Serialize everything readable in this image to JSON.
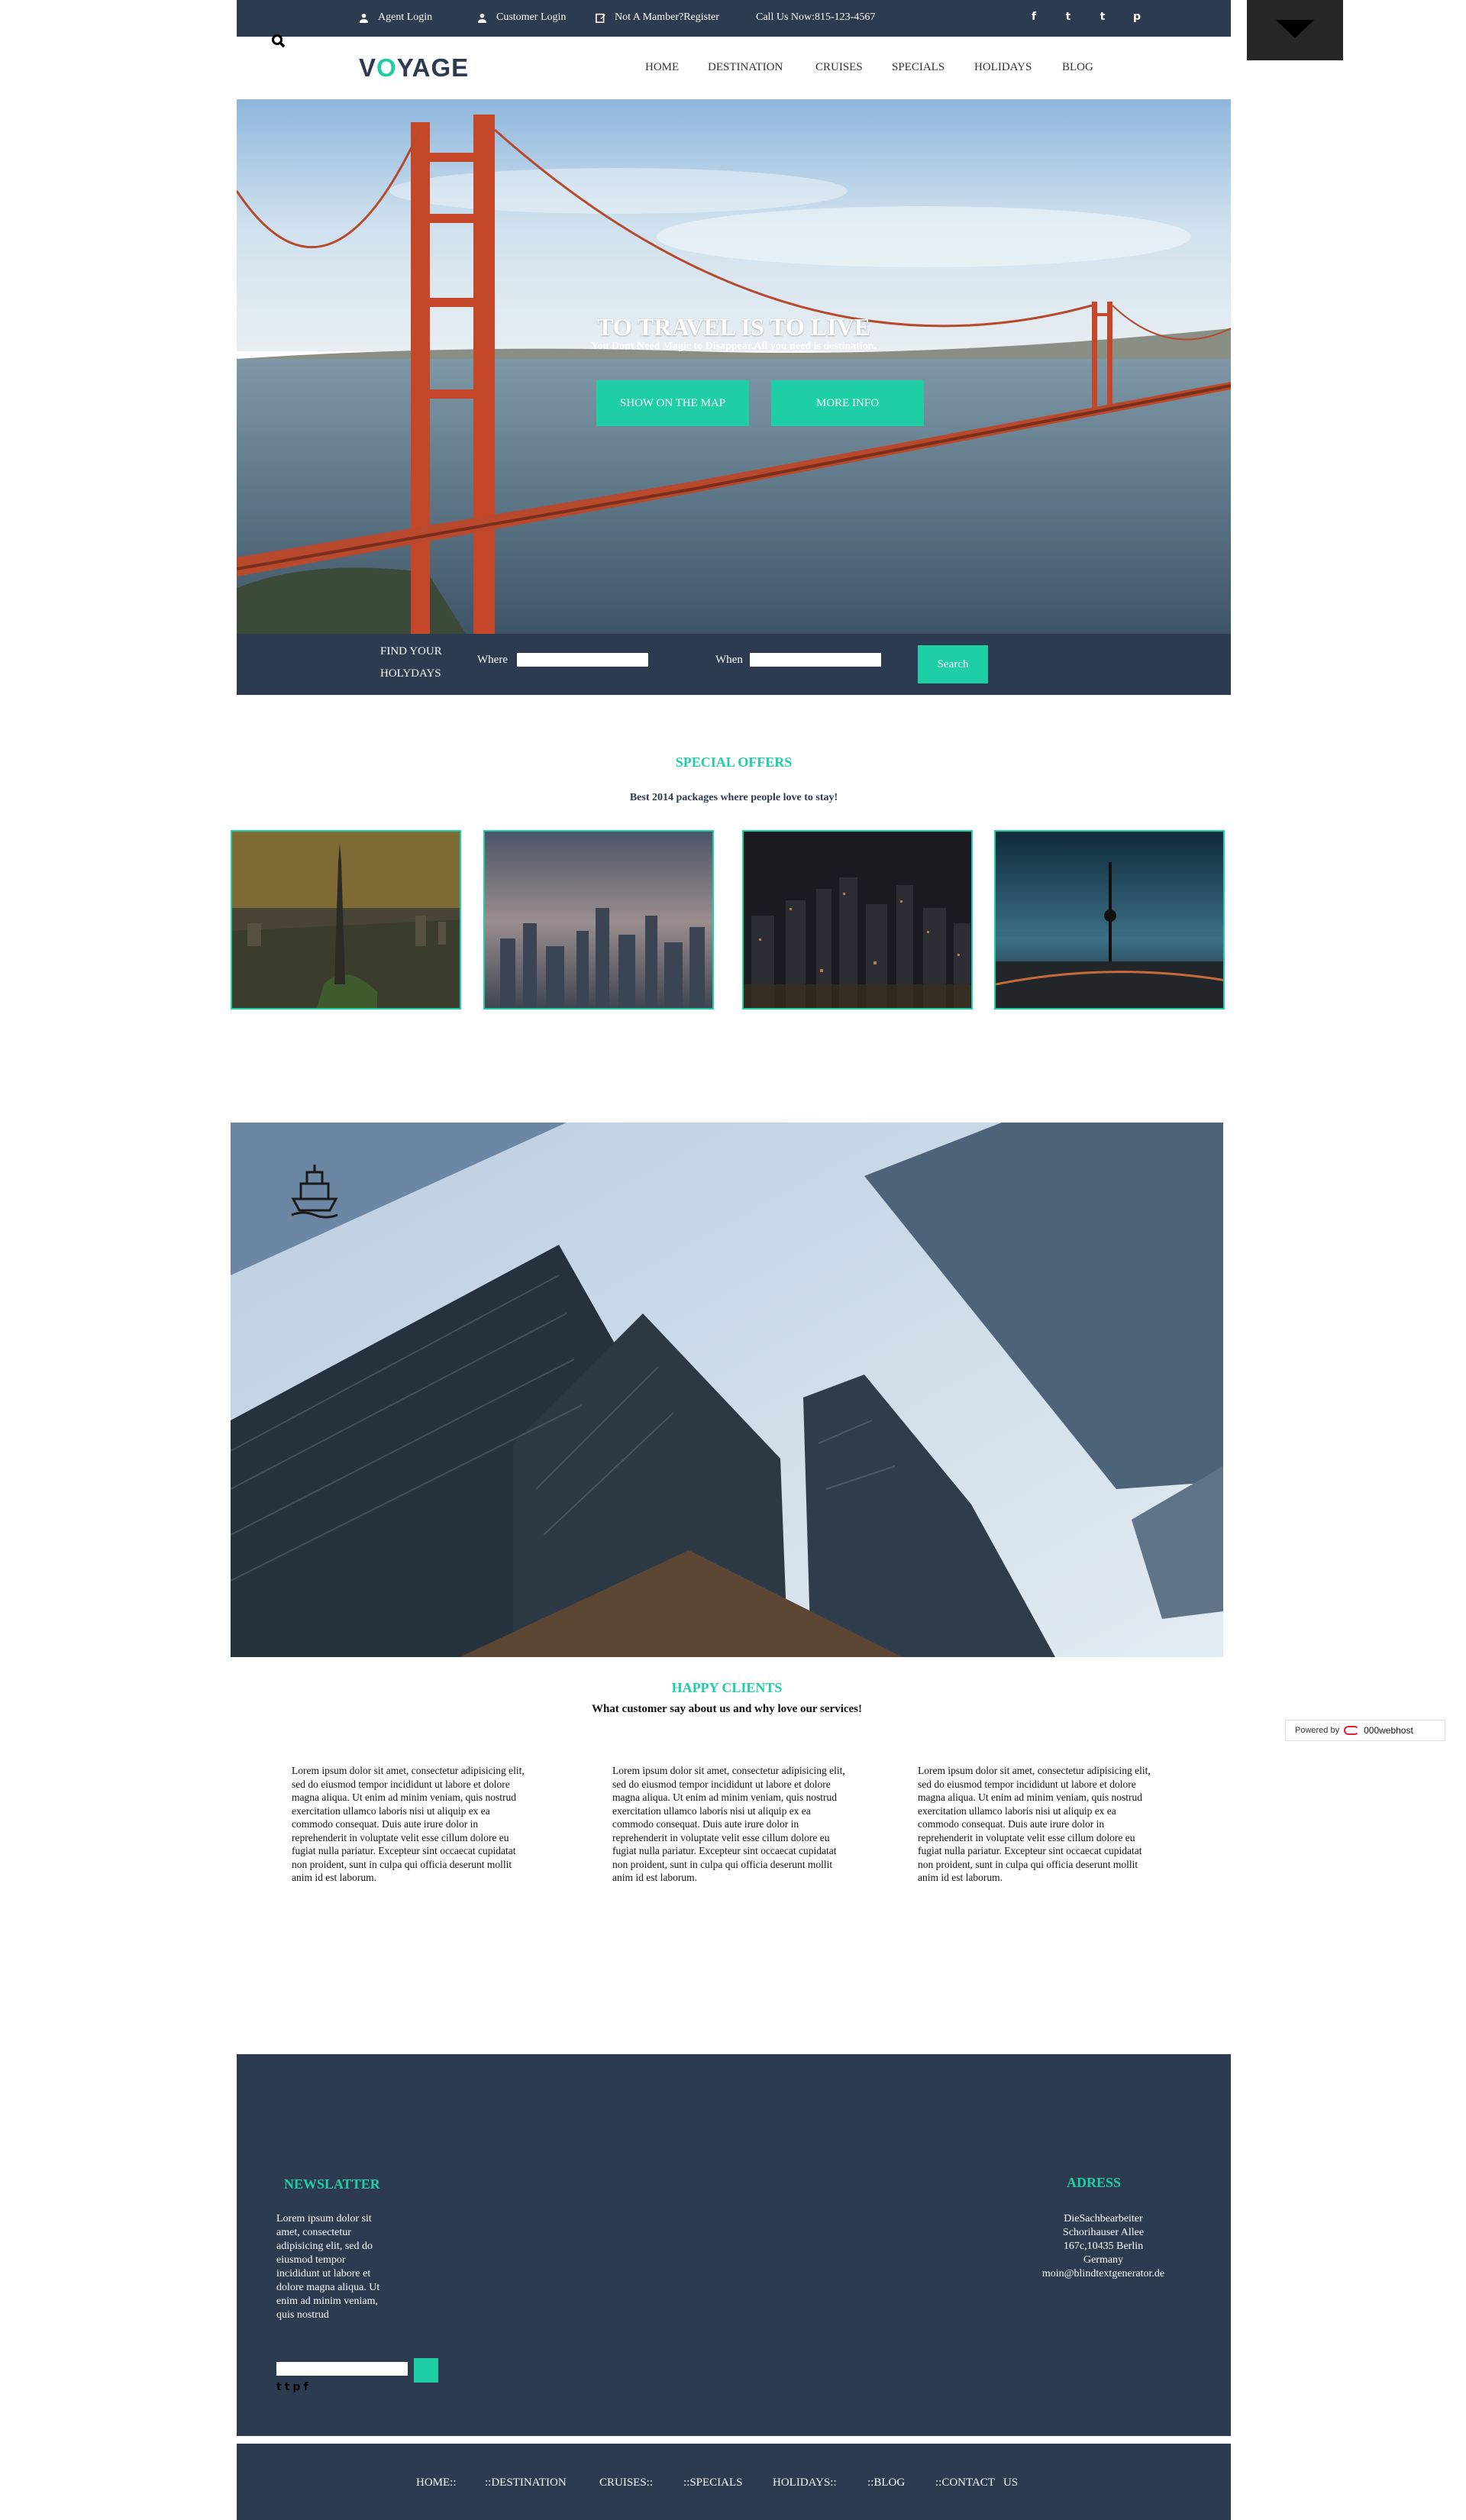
{
  "topbar": {
    "agent_login": "Agent Login",
    "customer_login": "Customer Login",
    "register": "Not A Mamber?Register",
    "call": "Call Us Now:815-123-4567",
    "social": [
      "f",
      "t",
      "t",
      "p"
    ]
  },
  "header": {
    "logo_v": "V",
    "logo_o": "O",
    "logo_rest": "YAGE",
    "nav": [
      "HOME",
      "DESTINATION",
      "CRUISES",
      "SPECIALS",
      "HOLIDAYS",
      "BLOG"
    ]
  },
  "hero": {
    "title": "TO TRAVEL IS TO LIVE",
    "subtitle": "You Dont Need Magic to Disappear.All you need is destination.",
    "btn_map": "SHOW ON THE MAP",
    "btn_info": "MORE INFO"
  },
  "searchbar": {
    "find_line1": "FIND YOUR",
    "find_line2": "HOLYDAYS",
    "where_label": "Where",
    "where_value": "",
    "when_label": "When",
    "when_value": "",
    "search_label": "Search"
  },
  "offers": {
    "title": "SPECIAL OFFERS",
    "subtitle": "Best 2014 packages where people love to stay!"
  },
  "clients": {
    "title": "HAPPY CLIENTS",
    "subtitle": "What customer say about us and why love our services!",
    "testimonials": [
      "Lorem ipsum dolor sit amet, consectetur adipisicing elit, sed do eiusmod tempor incididunt ut labore et dolore magna aliqua. Ut enim ad minim veniam, quis nostrud exercitation ullamco laboris nisi ut aliquip ex ea commodo consequat. Duis aute irure dolor in reprehenderit in voluptate velit esse cillum dolore eu fugiat nulla pariatur. Excepteur sint occaecat cupidatat non proident, sunt in culpa qui officia deserunt mollit anim id est laborum.",
      "Lorem ipsum dolor sit amet, consectetur adipisicing elit, sed do eiusmod tempor incididunt ut labore et dolore magna aliqua. Ut enim ad minim veniam, quis nostrud exercitation ullamco laboris nisi ut aliquip ex ea commodo consequat. Duis aute irure dolor in reprehenderit in voluptate velit esse cillum dolore eu fugiat nulla pariatur. Excepteur sint occaecat cupidatat non proident, sunt in culpa qui officia deserunt mollit anim id est laborum.",
      "Lorem ipsum dolor sit amet, consectetur adipisicing elit, sed do eiusmod tempor incididunt ut labore et dolore magna aliqua. Ut enim ad minim veniam, quis nostrud exercitation ullamco laboris nisi ut aliquip ex ea commodo consequat. Duis aute irure dolor in reprehenderit in voluptate velit esse cillum dolore eu fugiat nulla pariatur. Excepteur sint occaecat cupidatat non proident, sunt in culpa qui officia deserunt mollit anim id est laborum."
    ]
  },
  "footer": {
    "newsletter_title": "NEWSLATTER",
    "newsletter_text": "Lorem ipsum dolor sit amet, consectetur adipisicing elit, sed do eiusmod tempor incididunt ut labore et dolore magna aliqua. Ut enim ad minim veniam, quis nostrud",
    "newsletter_value": "",
    "social": [
      "t",
      "t",
      "p",
      "f"
    ],
    "address_title": "ADRESS",
    "address_lines": [
      "DieSachbearbeiter",
      "Schorihauser Allee",
      "167c,10435 Berlin",
      "Germany",
      "moin@blindtextgenerator.de"
    ]
  },
  "bottom_nav": [
    "HOME::",
    "::DESTINATION",
    "CRUISES::",
    "::SPECIALS",
    "HOLIDAYS::",
    "::BLOG",
    "::CONTACT   US"
  ],
  "powered": {
    "label": "Powered by",
    "host": "000webhost"
  },
  "colors": {
    "navy": "#2c3b50",
    "accent": "#1ecfa6"
  }
}
